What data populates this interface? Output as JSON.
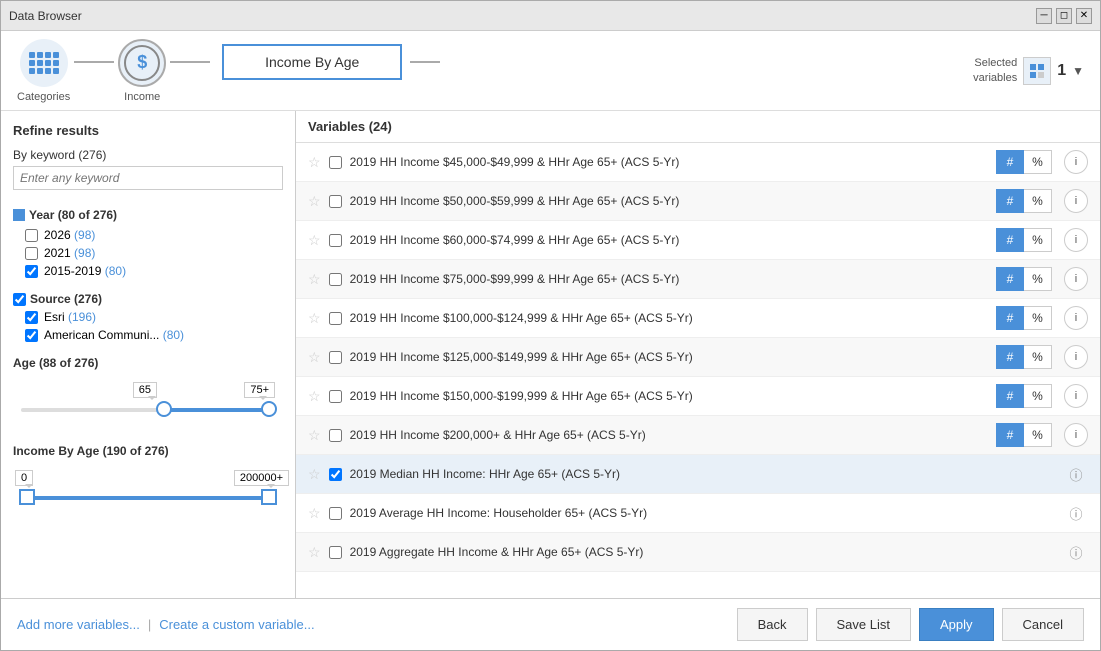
{
  "window": {
    "title": "Data Browser"
  },
  "nav": {
    "categories_label": "Categories",
    "income_label": "Income",
    "selected_box_label": "Income By Age",
    "selected_vars_label": "Selected\nvariables",
    "selected_vars_count": "1",
    "selected_vars_line1": "Selected",
    "selected_vars_line2": "variables"
  },
  "left_panel": {
    "refine_title": "Refine results",
    "keyword_label": "By keyword (276)",
    "keyword_placeholder": "Enter any keyword",
    "year_label": "Year (80 of 276)",
    "year_items": [
      {
        "label": "2026",
        "count": "(98)",
        "checked": false
      },
      {
        "label": "2021",
        "count": "(98)",
        "checked": false
      },
      {
        "label": "2015-2019",
        "count": "(80)",
        "checked": true
      }
    ],
    "source_label": "Source (276)",
    "source_items": [
      {
        "label": "Esri",
        "count": "(196)",
        "checked": true
      },
      {
        "label": "American Communi...",
        "count": "(80)",
        "checked": true
      }
    ],
    "age_label": "Age (88 of 276)",
    "age_min": "65",
    "age_max": "75+",
    "income_label": "Income By Age (190 of 276)",
    "income_min": "0",
    "income_max": "200000+"
  },
  "right_panel": {
    "variables_header": "Variables (24)",
    "variables": [
      {
        "name": "2019 HH Income $45,000-$49,999 & HHr Age 65+ (ACS 5-Yr)",
        "starred": false,
        "checked": false,
        "hash": true,
        "pct": false,
        "highlight": false
      },
      {
        "name": "2019 HH Income $50,000-$59,999 & HHr Age 65+ (ACS 5-Yr)",
        "starred": false,
        "checked": false,
        "hash": true,
        "pct": false,
        "highlight": false
      },
      {
        "name": "2019 HH Income $60,000-$74,999 & HHr Age 65+ (ACS 5-Yr)",
        "starred": false,
        "checked": false,
        "hash": true,
        "pct": false,
        "highlight": false
      },
      {
        "name": "2019 HH Income $75,000-$99,999 & HHr Age 65+ (ACS 5-Yr)",
        "starred": false,
        "checked": false,
        "hash": true,
        "pct": false,
        "highlight": false
      },
      {
        "name": "2019 HH Income $100,000-$124,999 & HHr Age 65+ (ACS 5-Yr)",
        "starred": false,
        "checked": false,
        "hash": true,
        "pct": false,
        "highlight": false
      },
      {
        "name": "2019 HH Income $125,000-$149,999 & HHr Age 65+ (ACS 5-Yr)",
        "starred": false,
        "checked": false,
        "hash": true,
        "pct": false,
        "highlight": false
      },
      {
        "name": "2019 HH Income $150,000-$199,999 & HHr Age 65+ (ACS 5-Yr)",
        "starred": false,
        "checked": false,
        "hash": true,
        "pct": false,
        "highlight": false
      },
      {
        "name": "2019 HH Income $200,000+ & HHr Age 65+ (ACS 5-Yr)",
        "starred": false,
        "checked": false,
        "hash": true,
        "pct": false,
        "highlight": false
      },
      {
        "name": "2019 Median HH Income: HHr Age 65+ (ACS 5-Yr)",
        "starred": false,
        "checked": true,
        "hash": false,
        "pct": false,
        "highlight": true
      },
      {
        "name": "2019 Average HH Income: Householder 65+ (ACS 5-Yr)",
        "starred": false,
        "checked": false,
        "hash": false,
        "pct": false,
        "highlight": false
      },
      {
        "name": "2019 Aggregate HH Income & HHr Age 65+ (ACS 5-Yr)",
        "starred": false,
        "checked": false,
        "hash": false,
        "pct": false,
        "highlight": false
      }
    ]
  },
  "bottom": {
    "add_link": "Add more variables...",
    "create_link": "Create a custom variable...",
    "back_btn": "Back",
    "save_btn": "Save List",
    "apply_btn": "Apply",
    "cancel_btn": "Cancel"
  }
}
